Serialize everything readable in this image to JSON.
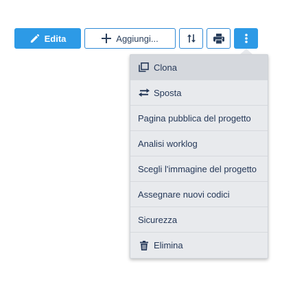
{
  "toolbar": {
    "edit_label": "Edita",
    "add_label": "Aggiungi...",
    "icons": {
      "edit": "pencil-icon",
      "add": "plus-icon",
      "sort": "sort-arrows-icon",
      "print": "printer-icon",
      "more": "vertical-ellipsis-icon"
    }
  },
  "menu": {
    "items": [
      {
        "label": "Clona",
        "icon": "clone-icon",
        "active": true
      },
      {
        "label": "Sposta",
        "icon": "swap-arrows-icon"
      },
      {
        "label": "Pagina pubblica del progetto"
      },
      {
        "label": "Analisi worklog"
      },
      {
        "label": "Scegli l'immagine del progetto"
      },
      {
        "label": "Assegnare nuovi codici"
      },
      {
        "label": "Sicurezza"
      },
      {
        "label": "Elimina",
        "icon": "trash-icon"
      }
    ]
  },
  "colors": {
    "primary": "#2d9ae6",
    "outline_border": "#2d89d6",
    "menu_bg": "#e8eaed",
    "menu_active_bg": "#d5d8dd",
    "text": "#253858"
  }
}
